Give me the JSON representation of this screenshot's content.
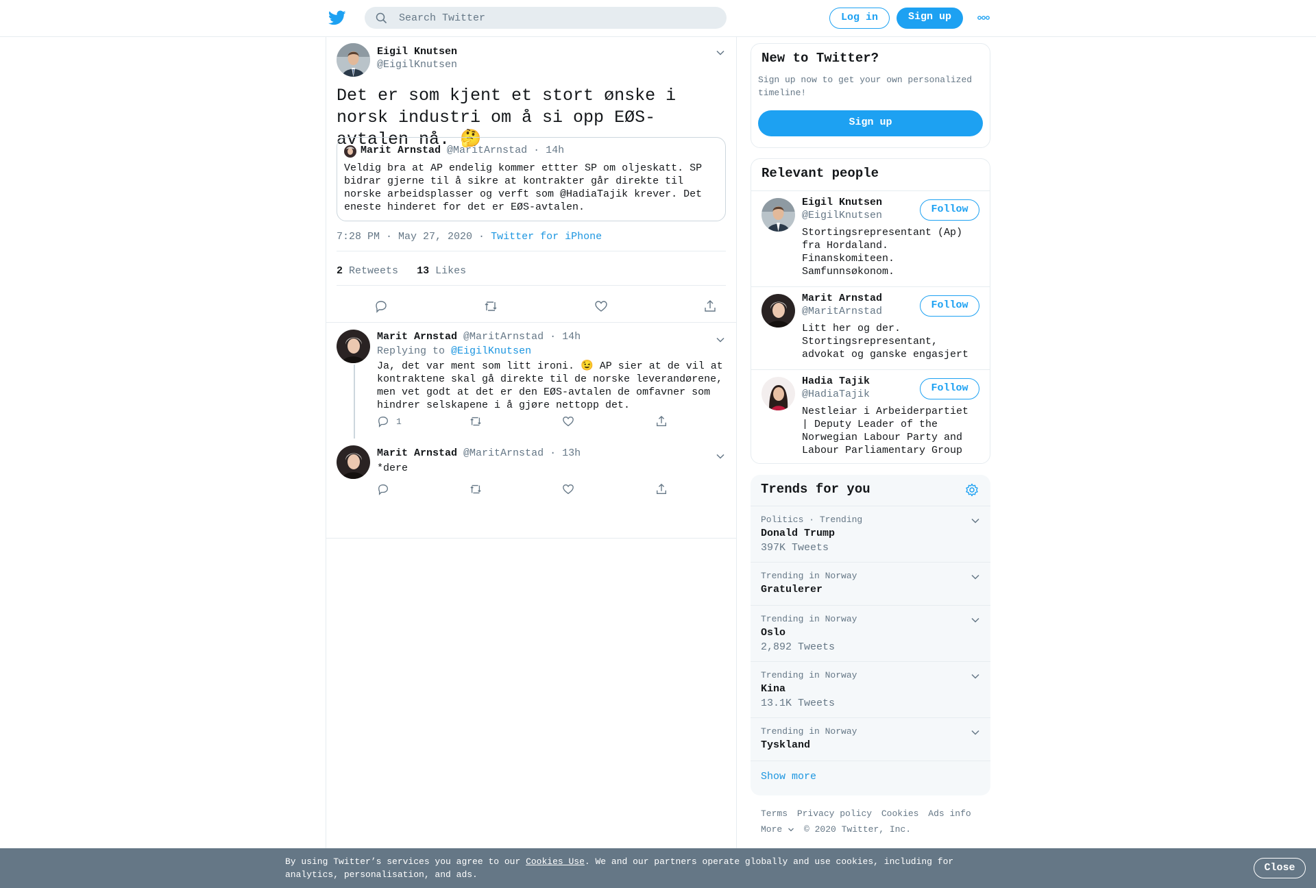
{
  "header": {
    "search_placeholder": "Search Twitter",
    "login_label": "Log in",
    "signup_label": "Sign up"
  },
  "focus_tweet": {
    "author_name": "Eigil Knutsen",
    "author_handle": "@EigilKnutsen",
    "text": "Det er som kjent et stort ønske i norsk industri om å si opp EØS-avtalen nå. 🤔",
    "quote": {
      "author_name": "Marit Arnstad",
      "author_handle": "@MaritArnstad",
      "time": "· 14h",
      "text": "Veldig bra at AP endelig kommer ettter SP om oljeskatt. SP bidrar gjerne til å sikre at kontrakter går direkte til norske arbeidsplasser og verft som @HadiaTajik  krever. Det eneste hinderet for det er EØS-avtalen."
    },
    "timestamp": "7:28 PM · May 27, 2020 ·",
    "source": "Twitter for iPhone",
    "retweets_count": "2",
    "retweets_label": "Retweets",
    "likes_count": "13",
    "likes_label": "Likes"
  },
  "replies": [
    {
      "author_name": "Marit Arnstad",
      "author_handle": "@MaritArnstad",
      "time": "· 14h",
      "replying_prefix": "Replying to",
      "replying_to": "@EigilKnutsen",
      "text": "Ja, det var ment som litt ironi. 😉 AP sier at de vil at kontraktene skal gå direkte til de norske leverandørene, men vet godt at det er den EØS-avtalen de omfavner som hindrer selskapene i å gjøre nettopp det.",
      "reply_count": "1"
    },
    {
      "author_name": "Marit Arnstad",
      "author_handle": "@MaritArnstad",
      "time": "· 13h",
      "text": "*dere"
    }
  ],
  "sidebar": {
    "new_title": "New to Twitter?",
    "new_desc": "Sign up now to get your own personalized timeline!",
    "signup_label": "Sign up",
    "relevant_title": "Relevant people",
    "follow_label": "Follow",
    "people": [
      {
        "name": "Eigil Knutsen",
        "handle": "@EigilKnutsen",
        "bio": "Stortingsrepresentant (Ap) fra Hordaland. Finanskomiteen. Samfunnsøkonom."
      },
      {
        "name": "Marit Arnstad",
        "handle": "@MaritArnstad",
        "bio": "Litt her og der. Stortingsrepresentant, advokat og ganske engasjert"
      },
      {
        "name": "Hadia Tajik",
        "handle": "@HadiaTajik",
        "bio": "Nestleiar i Arbeiderpartiet | Deputy Leader of the Norwegian Labour Party and Labour Parliamentary Group"
      }
    ],
    "trends_title": "Trends for you",
    "trends": [
      {
        "context": "Politics · Trending",
        "name": "Donald Trump",
        "count": "397K Tweets"
      },
      {
        "context": "Trending in Norway",
        "name": "Gratulerer",
        "count": ""
      },
      {
        "context": "Trending in Norway",
        "name": "Oslo",
        "count": "2,892 Tweets"
      },
      {
        "context": "Trending in Norway",
        "name": "Kina",
        "count": "13.1K Tweets"
      },
      {
        "context": "Trending in Norway",
        "name": "Tyskland",
        "count": ""
      }
    ],
    "show_more": "Show more"
  },
  "footer": {
    "links": [
      "Terms",
      "Privacy policy",
      "Cookies",
      "Ads info"
    ],
    "more": "More",
    "copyright": "© 2020 Twitter, Inc."
  },
  "cookie": {
    "text_before": "By using Twitter’s services you agree to our ",
    "link": "Cookies Use",
    "text_after": ". We and our partners operate globally and use cookies, including for analytics, personalisation, and ads.",
    "close_label": "Close"
  },
  "colors": {
    "accent": "#1da1f2",
    "secondary_text": "#657786",
    "border": "#e6ecf0",
    "cookie_bar": "#657786"
  }
}
